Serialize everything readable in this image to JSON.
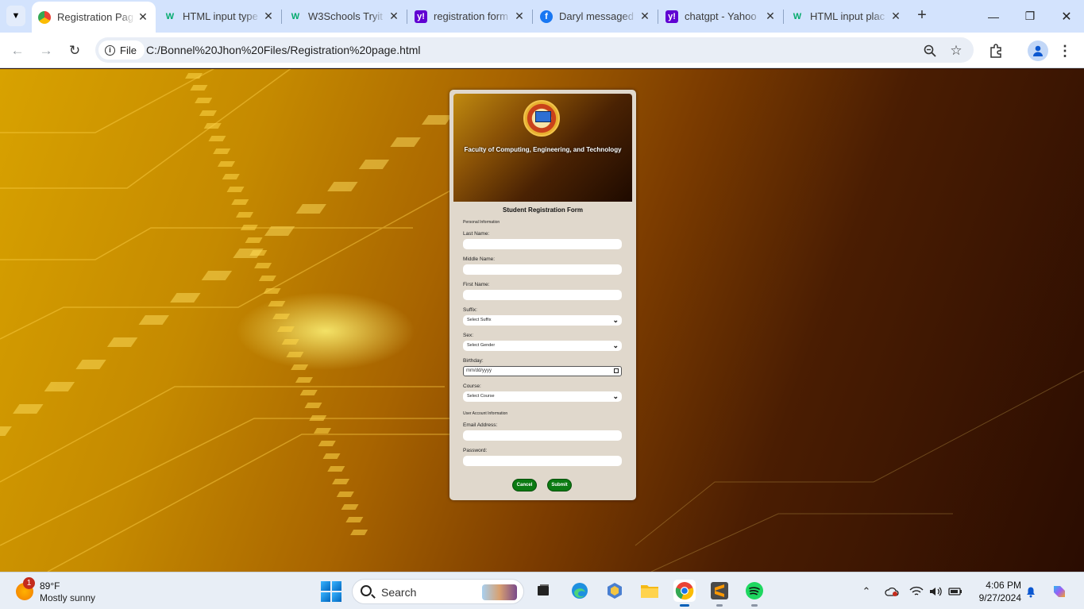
{
  "browser": {
    "tabs": [
      {
        "title": "Registration Pag",
        "favicon": "chrome-page-icon",
        "active": true
      },
      {
        "title": "HTML input type",
        "favicon": "w3schools-icon",
        "active": false
      },
      {
        "title": "W3Schools Tryit",
        "favicon": "w3schools-icon",
        "active": false
      },
      {
        "title": "registration form",
        "favicon": "yahoo-icon",
        "active": false
      },
      {
        "title": "Daryl messaged",
        "favicon": "facebook-icon",
        "active": false
      },
      {
        "title": "chatgpt - Yahoo",
        "favicon": "yahoo-icon",
        "active": false
      },
      {
        "title": "HTML input plac",
        "favicon": "w3schools-icon",
        "active": false
      }
    ],
    "address": {
      "chip": "File",
      "url": "C:/Bonnel%20Jhon%20Files/Registration%20page.html"
    }
  },
  "form": {
    "banner_title": "Faculty of Computing, Engineering, and Technology",
    "title": "Student Registration Form",
    "personal_section": "Personal Information",
    "last_name_label": "Last Name:",
    "middle_name_label": "Middle Name:",
    "first_name_label": "First Name:",
    "suffix_label": "Suffix:",
    "suffix_value": "Select Suffix",
    "sex_label": "Sex:",
    "sex_value": "Select Gender",
    "birthday_label": "Birthday:",
    "birthday_placeholder": "mm/dd/yyyy",
    "course_label": "Course:",
    "course_value": "Select Course",
    "account_section": "User Account Information",
    "email_label": "Email Address:",
    "password_label": "Password:",
    "cancel_label": "Cancel",
    "submit_label": "Submit"
  },
  "taskbar": {
    "weather_temp": "89°F",
    "weather_desc": "Mostly sunny",
    "weather_badge": "1",
    "search_label": "Search",
    "time": "4:06 PM",
    "date": "9/27/2024"
  },
  "colors": {
    "tabstrip": "#d3e3fd",
    "form_card": "#e0d8cc",
    "button_green": "#0b7a12"
  }
}
